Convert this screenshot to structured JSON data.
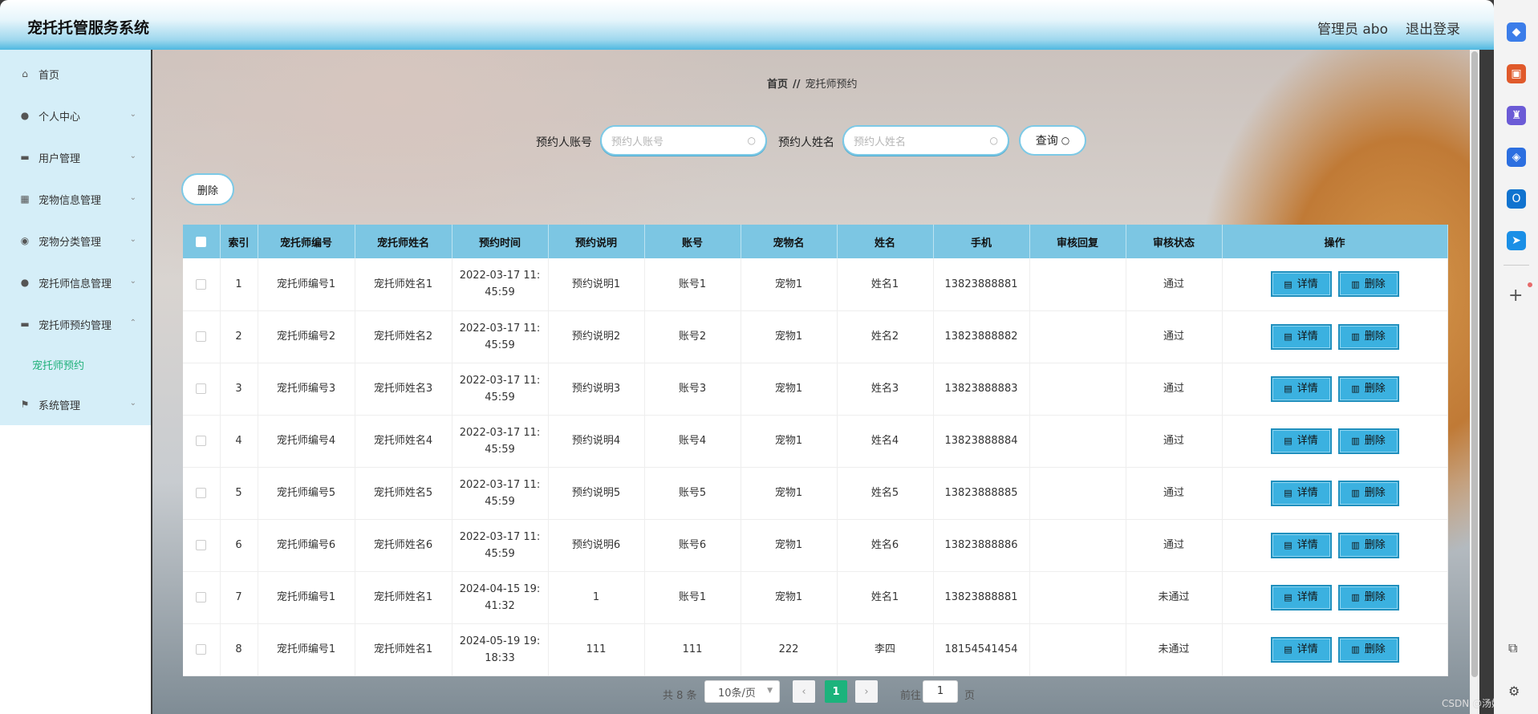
{
  "header": {
    "title": "宠托托管服务系统",
    "admin": "管理员 abo",
    "logout": "退出登录"
  },
  "sidebar": {
    "items": [
      {
        "label": "首页",
        "icon": "home-icon",
        "glyph": "⌂"
      },
      {
        "label": "个人中心",
        "icon": "user-icon",
        "glyph": "●"
      },
      {
        "label": "用户管理",
        "icon": "chat-icon",
        "glyph": "▬"
      },
      {
        "label": "宠物信息管理",
        "icon": "grid-icon",
        "glyph": "▦"
      },
      {
        "label": "宠物分类管理",
        "icon": "pin-icon",
        "glyph": "◉"
      },
      {
        "label": "宠托师信息管理",
        "icon": "user-icon",
        "glyph": "●"
      },
      {
        "label": "宠托师预约管理",
        "icon": "chat-icon",
        "glyph": "▬"
      },
      {
        "label": "系统管理",
        "icon": "flag-icon",
        "glyph": "⚑"
      }
    ],
    "sub_item": "宠托师预约"
  },
  "breadcrumb": {
    "home": "首页",
    "sep": "//",
    "current": "宠托师预约"
  },
  "search": {
    "account_label": "预约人账号",
    "account_placeholder": "预约人账号",
    "name_label": "预约人姓名",
    "name_placeholder": "预约人姓名",
    "query_label": "查询"
  },
  "toolbar": {
    "delete_label": "删除"
  },
  "table": {
    "headers": [
      "",
      "索引",
      "宠托师编号",
      "宠托师姓名",
      "预约时间",
      "预约说明",
      "账号",
      "宠物名",
      "姓名",
      "手机",
      "审核回复",
      "审核状态",
      "操作"
    ],
    "detail_label": "详情",
    "delete_label": "删除",
    "rows": [
      {
        "index": "1",
        "code": "宠托师编号1",
        "caretaker": "宠托师姓名1",
        "time1": "2022-03-17 11:",
        "time2": "45:59",
        "note": "预约说明1",
        "account": "账号1",
        "pet": "宠物1",
        "name": "姓名1",
        "phone": "13823888881",
        "reply": "",
        "status": "通过"
      },
      {
        "index": "2",
        "code": "宠托师编号2",
        "caretaker": "宠托师姓名2",
        "time1": "2022-03-17 11:",
        "time2": "45:59",
        "note": "预约说明2",
        "account": "账号2",
        "pet": "宠物1",
        "name": "姓名2",
        "phone": "13823888882",
        "reply": "",
        "status": "通过"
      },
      {
        "index": "3",
        "code": "宠托师编号3",
        "caretaker": "宠托师姓名3",
        "time1": "2022-03-17 11:",
        "time2": "45:59",
        "note": "预约说明3",
        "account": "账号3",
        "pet": "宠物1",
        "name": "姓名3",
        "phone": "13823888883",
        "reply": "",
        "status": "通过"
      },
      {
        "index": "4",
        "code": "宠托师编号4",
        "caretaker": "宠托师姓名4",
        "time1": "2022-03-17 11:",
        "time2": "45:59",
        "note": "预约说明4",
        "account": "账号4",
        "pet": "宠物1",
        "name": "姓名4",
        "phone": "13823888884",
        "reply": "",
        "status": "通过"
      },
      {
        "index": "5",
        "code": "宠托师编号5",
        "caretaker": "宠托师姓名5",
        "time1": "2022-03-17 11:",
        "time2": "45:59",
        "note": "预约说明5",
        "account": "账号5",
        "pet": "宠物1",
        "name": "姓名5",
        "phone": "13823888885",
        "reply": "",
        "status": "通过"
      },
      {
        "index": "6",
        "code": "宠托师编号6",
        "caretaker": "宠托师姓名6",
        "time1": "2022-03-17 11:",
        "time2": "45:59",
        "note": "预约说明6",
        "account": "账号6",
        "pet": "宠物1",
        "name": "姓名6",
        "phone": "13823888886",
        "reply": "",
        "status": "通过"
      },
      {
        "index": "7",
        "code": "宠托师编号1",
        "caretaker": "宠托师姓名1",
        "time1": "2024-04-15 19:",
        "time2": "41:32",
        "note": "1",
        "account": "账号1",
        "pet": "宠物1",
        "name": "姓名1",
        "phone": "13823888881",
        "reply": "",
        "status": "未通过"
      },
      {
        "index": "8",
        "code": "宠托师编号1",
        "caretaker": "宠托师姓名1",
        "time1": "2024-05-19 19:",
        "time2": "18:33",
        "note": "111",
        "account": "111",
        "pet": "222",
        "name": "李四",
        "phone": "18154541454",
        "reply": "",
        "status": "未通过"
      }
    ]
  },
  "pager": {
    "total": "共 8 条",
    "page_size": "10条/页",
    "prev": "‹",
    "current": "1",
    "next": "›",
    "goto": "前往",
    "goto_value": "1",
    "page_suffix": "页"
  },
  "watermark": "CSDN @汤姆猫",
  "dock": {
    "icons": [
      {
        "name": "tag-icon",
        "glyph": "◆",
        "color": "#3b7de9"
      },
      {
        "name": "toolbox-icon",
        "glyph": "▣",
        "color": "#e05a2b"
      },
      {
        "name": "chess-icon",
        "glyph": "♜",
        "color": "#6b5bd6"
      },
      {
        "name": "copilot-icon",
        "glyph": "◈",
        "color": "#2c6fe0"
      },
      {
        "name": "outlook-icon",
        "glyph": "O",
        "color": "#1073cf"
      },
      {
        "name": "send-icon",
        "glyph": "➤",
        "color": "#1a8fe6"
      }
    ]
  },
  "colors": {
    "accent_green": "#1cb37c",
    "header_blue": "#4fb8e0",
    "table_head": "#7cc6e3",
    "action_blue": "#3bb1e0"
  }
}
